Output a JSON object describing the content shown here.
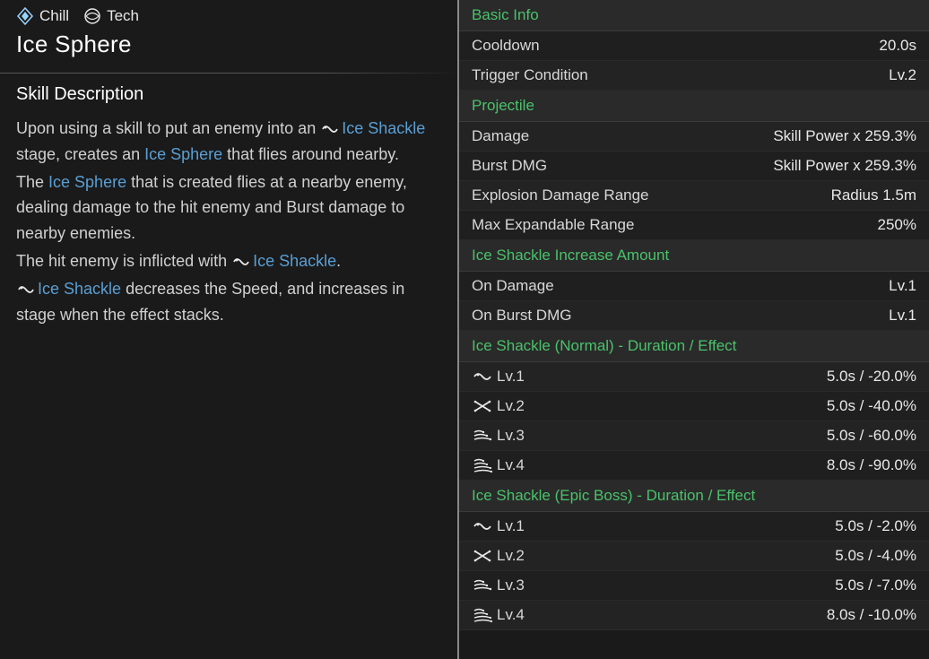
{
  "tags": [
    {
      "icon": "chill-icon",
      "label": "Chill"
    },
    {
      "icon": "tech-icon",
      "label": "Tech"
    }
  ],
  "skill_name": "Ice Sphere",
  "section_title": "Skill Description",
  "description": {
    "p1a": "Upon using a skill to put an enemy into an ",
    "p1_kw1": "Ice Shackle",
    "p1b": " stage, creates an ",
    "p1_kw2": "Ice Sphere",
    "p1c": " that flies around nearby.",
    "p2a": "The ",
    "p2_kw1": "Ice Sphere",
    "p2b": " that is created flies at a nearby enemy, dealing damage to the hit enemy and Burst damage to nearby enemies.",
    "p3a": "The hit enemy is inflicted with ",
    "p3_kw1": "Ice Shackle",
    "p3b": ".",
    "p4_kw1": "Ice Shackle",
    "p4a": " decreases the Speed, and increases in stage when the effect stacks."
  },
  "stats": {
    "groups": [
      {
        "header": "Basic Info",
        "rows": [
          {
            "label": "Cooldown",
            "value": "20.0s"
          },
          {
            "label": "Trigger Condition",
            "value": "Lv.2"
          }
        ]
      },
      {
        "header": "Projectile",
        "rows": [
          {
            "label": "Damage",
            "value": "Skill Power x 259.3%"
          },
          {
            "label": "Burst DMG",
            "value": "Skill Power x 259.3%"
          },
          {
            "label": "Explosion Damage Range",
            "value": "Radius 1.5m"
          },
          {
            "label": "Max Expandable Range",
            "value": "250%"
          }
        ]
      },
      {
        "header": "Ice Shackle Increase Amount",
        "rows": [
          {
            "label": "On Damage",
            "value": "Lv.1"
          },
          {
            "label": "On Burst DMG",
            "value": "Lv.1"
          }
        ]
      },
      {
        "header": "Ice Shackle (Normal) - Duration / Effect",
        "rows": [
          {
            "icon": "lv1",
            "label": "Lv.1",
            "value": "5.0s / -20.0%"
          },
          {
            "icon": "lv2",
            "label": "Lv.2",
            "value": "5.0s / -40.0%"
          },
          {
            "icon": "lv3",
            "label": "Lv.3",
            "value": "5.0s / -60.0%"
          },
          {
            "icon": "lv4",
            "label": "Lv.4",
            "value": "8.0s / -90.0%"
          }
        ]
      },
      {
        "header": "Ice Shackle (Epic Boss) - Duration / Effect",
        "rows": [
          {
            "icon": "lv1",
            "label": "Lv.1",
            "value": "5.0s / -2.0%"
          },
          {
            "icon": "lv2",
            "label": "Lv.2",
            "value": "5.0s / -4.0%"
          },
          {
            "icon": "lv3",
            "label": "Lv.3",
            "value": "5.0s / -7.0%"
          },
          {
            "icon": "lv4",
            "label": "Lv.4",
            "value": "8.0s / -10.0%"
          }
        ]
      }
    ]
  }
}
